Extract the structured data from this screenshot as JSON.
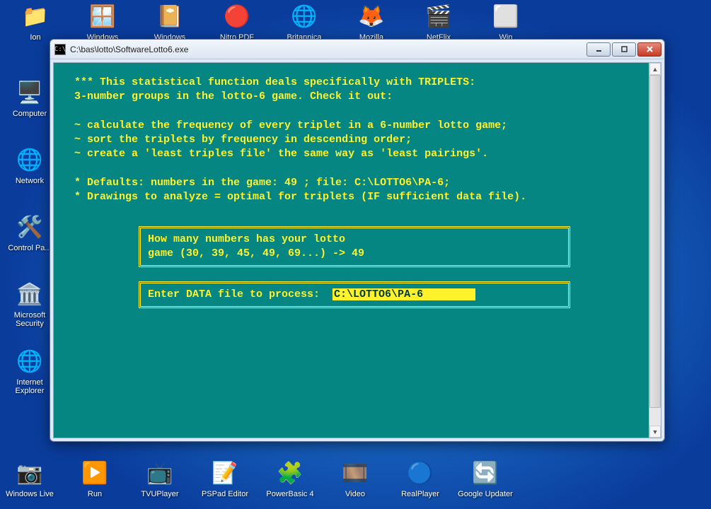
{
  "desktop": {
    "top_row": [
      {
        "label": "Ion",
        "glyph": "📁"
      },
      {
        "label": "Windows",
        "glyph": "🪟"
      },
      {
        "label": "Windows",
        "glyph": "📔"
      },
      {
        "label": "Nitro PDF",
        "glyph": "🔴"
      },
      {
        "label": "Britannica",
        "glyph": "🌐"
      },
      {
        "label": "Mozilla",
        "glyph": "🦊"
      },
      {
        "label": "NetFlix",
        "glyph": "🎬"
      },
      {
        "label": "Win",
        "glyph": "⬜"
      }
    ],
    "left_col": [
      {
        "label": "Computer",
        "glyph": "🖥️"
      },
      {
        "label": "Network",
        "glyph": "🌐"
      },
      {
        "label": "Control Pa...",
        "glyph": "🛠️"
      },
      {
        "label": "Microsoft Security",
        "glyph": "🏛️"
      },
      {
        "label": "Internet Explorer",
        "glyph": "🌐"
      }
    ],
    "bottom_row": [
      {
        "label": "Windows Live",
        "glyph": "📷"
      },
      {
        "label": "Run",
        "glyph": "▶️"
      },
      {
        "label": "TVUPlayer",
        "glyph": "📺"
      },
      {
        "label": "PSPad Editor",
        "glyph": "📝"
      },
      {
        "label": "PowerBasic 4",
        "glyph": "🧩"
      },
      {
        "label": "Video",
        "glyph": "🎞️"
      },
      {
        "label": "RealPlayer",
        "glyph": "🔵"
      },
      {
        "label": "Google Updater",
        "glyph": "🔄"
      }
    ]
  },
  "window": {
    "title": "C:\\bas\\lotto\\SoftwareLotto6.exe",
    "app_glyph": "C:\\"
  },
  "console": {
    "lines": [
      " *** This statistical function deals specifically with TRIPLETS:",
      " 3-number groups in the lotto-6 game. Check it out:",
      "",
      " ~ calculate the frequency of every triplet in a 6-number lotto game;",
      " ~ sort the triplets by frequency in descending order;",
      " ~ create a 'least triples file' the same way as 'least pairings'.",
      "",
      " * Defaults: numbers in the game: 49 ; file: C:\\LOTTO6\\PA-6;",
      " * Drawings to analyze = optimal for triplets (IF sufficient data file)."
    ],
    "box1": "How many numbers has your lotto\ngame (30, 39, 45, 49, 69...) -> 49",
    "box2_prompt": "Enter DATA file to process:  ",
    "box2_value": "C:\\LOTTO6\\PA-6        "
  }
}
